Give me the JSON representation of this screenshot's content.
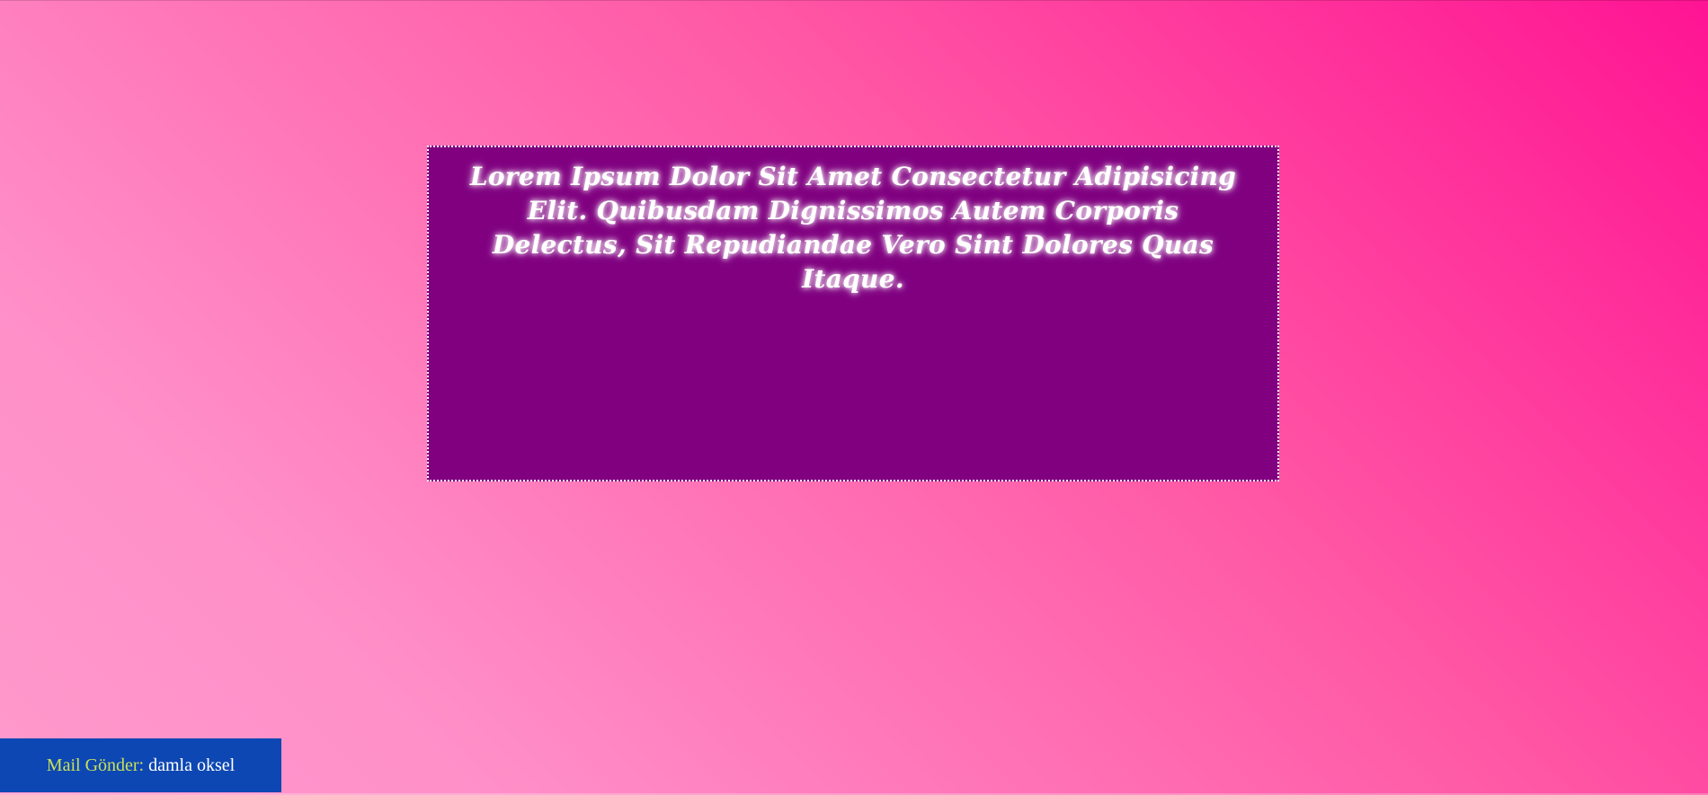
{
  "main": {
    "text": "Lorem Ipsum Dolor Sit Amet Consectetur Adipisicing Elit. Quibusdam Dignissimos Autem Corporis Delectus, Sit Repudiandae Vero Sint Dolores Quas Itaque."
  },
  "footer": {
    "mail_label": "Mail Gönder:",
    "mail_name": "damla oksel"
  },
  "colors": {
    "background_gradient": [
      "#ff1493",
      "#ff99cc"
    ],
    "box_background": "#800080",
    "box_border": "#ffffff",
    "footer_background": "#0d47b3",
    "mail_label_color": "#c8e05a",
    "mail_name_color": "#ffffff"
  }
}
